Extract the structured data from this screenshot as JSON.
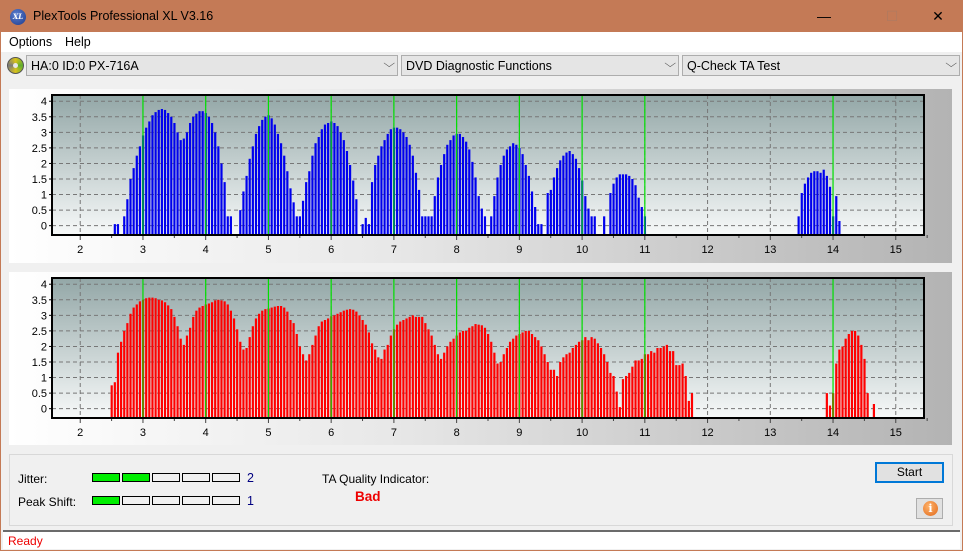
{
  "window": {
    "title": "PlexTools Professional XL V3.16",
    "app_icon_text": "XL",
    "minimize_glyph": "—",
    "maximize_glyph": "☐",
    "close_glyph": "✕"
  },
  "menu": {
    "items": [
      {
        "label": "Options"
      },
      {
        "label": "Help"
      }
    ]
  },
  "toolbar": {
    "drive_select": "HA:0 ID:0  PX-716A",
    "function_select": "DVD Diagnostic Functions",
    "test_select": "Q-Check TA Test",
    "chevron": "⌵"
  },
  "bottom": {
    "jitter_label": "Jitter:",
    "jitter_value": "2",
    "jitter_level": 2,
    "peak_shift_label": "Peak Shift:",
    "peak_shift_value": "1",
    "peak_shift_level": 1,
    "meter_segments": 5,
    "ta_quality_label": "TA Quality Indicator:",
    "ta_quality_value": "Bad",
    "start_label": "Start",
    "info_glyph": "i"
  },
  "status": {
    "text": "Ready"
  },
  "colors": {
    "titlebar": "#c47a56",
    "bar_top": "#0000ee",
    "bar_bottom": "#ff0000",
    "marker": "#00e000",
    "meter_on": "#00ee00",
    "quality_bad": "#ee0000"
  },
  "chart_data": [
    {
      "type": "bar",
      "name": "TA land/pit histogram (top)",
      "xlim": [
        1.55,
        15.45
      ],
      "ylim": [
        -0.3,
        4.2
      ],
      "xticks": [
        "2",
        "3",
        "4",
        "5",
        "6",
        "7",
        "8",
        "9",
        "10",
        "11",
        "12",
        "13",
        "14",
        "15"
      ],
      "yticks": [
        "0",
        "0.5",
        "1",
        "1.5",
        "2",
        "2.5",
        "3",
        "3.5",
        "4"
      ],
      "grid": true,
      "marker_lines_x": [
        3,
        4,
        5,
        6,
        7,
        8,
        9,
        10,
        11,
        14
      ],
      "x_start": 2.55,
      "x_step": 0.05,
      "values": [
        0.05,
        0.05,
        0,
        0.3,
        0.85,
        1.5,
        1.85,
        2.25,
        2.55,
        2.9,
        3.15,
        3.35,
        3.55,
        3.65,
        3.72,
        3.75,
        3.72,
        3.62,
        3.5,
        3.3,
        3.0,
        2.75,
        2.8,
        3.0,
        3.3,
        3.5,
        3.6,
        3.68,
        3.68,
        3.62,
        3.5,
        3.3,
        3.0,
        2.55,
        2.0,
        1.4,
        0.3,
        0.3,
        0,
        0,
        0.5,
        1.1,
        1.6,
        2.15,
        2.55,
        2.95,
        3.2,
        3.4,
        3.5,
        3.55,
        3.45,
        3.25,
        2.95,
        2.65,
        2.25,
        1.75,
        1.2,
        0.75,
        0.3,
        0.3,
        0.8,
        1.4,
        1.75,
        2.25,
        2.65,
        2.85,
        3.1,
        3.25,
        3.3,
        3.35,
        3.3,
        3.2,
        3.0,
        2.75,
        2.4,
        1.95,
        1.45,
        0.85,
        0,
        0.05,
        0.25,
        0.05,
        1.4,
        1.95,
        2.25,
        2.55,
        2.75,
        2.95,
        3.1,
        3.15,
        3.15,
        3.1,
        3.0,
        2.85,
        2.6,
        2.25,
        1.7,
        1.15,
        0.3,
        0.3,
        0.3,
        0.3,
        0.95,
        1.55,
        1.95,
        2.3,
        2.6,
        2.75,
        2.9,
        2.95,
        2.95,
        2.85,
        2.7,
        2.45,
        2.05,
        1.55,
        0.95,
        0.55,
        0.3,
        0,
        0.3,
        0.95,
        1.55,
        1.95,
        2.25,
        2.45,
        2.55,
        2.65,
        2.6,
        2.5,
        2.3,
        1.95,
        1.6,
        1.1,
        0.6,
        0.05,
        0.05,
        0,
        1.05,
        1.15,
        1.55,
        1.85,
        2.1,
        2.25,
        2.35,
        2.4,
        2.3,
        2.15,
        1.85,
        1.45,
        0.95,
        0.55,
        0.3,
        0.3,
        0,
        0,
        0.3,
        0,
        1.05,
        1.35,
        1.55,
        1.65,
        1.65,
        1.65,
        1.6,
        1.5,
        1.3,
        0.9,
        0.6,
        0.3
      ],
      "values_2_x_start": 13.45,
      "values_2": [
        0.3,
        1.05,
        1.35,
        1.55,
        1.7,
        1.75,
        1.75,
        1.7,
        1.8,
        1.6,
        1.25,
        0.3,
        0.95,
        0.15
      ]
    },
    {
      "type": "bar",
      "name": "TA land/pit histogram (bottom)",
      "xlim": [
        1.55,
        15.45
      ],
      "ylim": [
        -0.3,
        4.2
      ],
      "xticks": [
        "2",
        "3",
        "4",
        "5",
        "6",
        "7",
        "8",
        "9",
        "10",
        "11",
        "12",
        "13",
        "14",
        "15"
      ],
      "yticks": [
        "0",
        "0.5",
        "1",
        "1.5",
        "2",
        "2.5",
        "3",
        "3.5",
        "4"
      ],
      "grid": true,
      "marker_lines_x": [
        3,
        4,
        5,
        6,
        7,
        8,
        9,
        10,
        11,
        14
      ],
      "x_start": 2.5,
      "x_step": 0.05,
      "values": [
        0.75,
        0.85,
        1.8,
        2.15,
        2.5,
        2.75,
        3.05,
        3.25,
        3.35,
        3.45,
        3.5,
        3.55,
        3.57,
        3.57,
        3.55,
        3.5,
        3.48,
        3.42,
        3.32,
        3.2,
        2.95,
        2.65,
        2.25,
        2.05,
        2.35,
        2.6,
        2.95,
        3.15,
        3.25,
        3.3,
        3.35,
        3.38,
        3.42,
        3.48,
        3.5,
        3.48,
        3.45,
        3.35,
        3.15,
        2.9,
        2.55,
        2.15,
        1.9,
        1.95,
        2.3,
        2.65,
        2.9,
        3.05,
        3.15,
        3.2,
        3.22,
        3.25,
        3.28,
        3.3,
        3.3,
        3.25,
        3.12,
        2.85,
        2.75,
        2.4,
        2.0,
        1.75,
        1.55,
        1.75,
        2.05,
        2.35,
        2.65,
        2.8,
        2.85,
        2.9,
        2.97,
        3.0,
        3.05,
        3.1,
        3.15,
        3.18,
        3.2,
        3.18,
        3.12,
        3.0,
        2.85,
        2.7,
        2.45,
        2.1,
        1.9,
        1.65,
        1.6,
        1.9,
        2.05,
        2.35,
        2.55,
        2.7,
        2.8,
        2.85,
        2.9,
        2.95,
        3.0,
        2.95,
        2.95,
        2.95,
        2.75,
        2.55,
        2.35,
        2.05,
        1.75,
        1.6,
        1.8,
        2.0,
        2.15,
        2.25,
        2.35,
        2.45,
        2.5,
        2.5,
        2.6,
        2.65,
        2.72,
        2.7,
        2.68,
        2.6,
        2.4,
        2.15,
        1.8,
        1.45,
        1.5,
        1.75,
        1.95,
        2.15,
        2.25,
        2.35,
        2.4,
        2.45,
        2.5,
        2.5,
        2.4,
        2.3,
        2.2,
        2.0,
        1.75,
        1.5,
        1.25,
        1.25,
        1.05,
        1.5,
        1.65,
        1.75,
        1.8,
        1.95,
        2.05,
        2.15,
        2.2,
        2.3,
        2.2,
        2.3,
        2.25,
        2.1,
        1.95,
        1.75,
        1.5,
        1.15,
        1.05,
        0.55,
        0.05,
        0.95,
        1.05,
        1.15,
        1.35,
        1.55,
        1.55,
        1.6,
        1.75,
        1.75,
        1.85,
        1.8,
        1.95,
        1.95,
        2.0,
        2.05,
        1.85,
        1.85,
        1.4,
        1.4,
        1.45,
        1.05,
        0.25,
        0.5
      ],
      "values_2_x_start": 13.9,
      "values_2": [
        0.5,
        0.1,
        0.5,
        1.45,
        1.9,
        2.0,
        2.25,
        2.4,
        2.5,
        2.5,
        2.35,
        2.05,
        1.6,
        0.5,
        0,
        0.15
      ]
    }
  ]
}
